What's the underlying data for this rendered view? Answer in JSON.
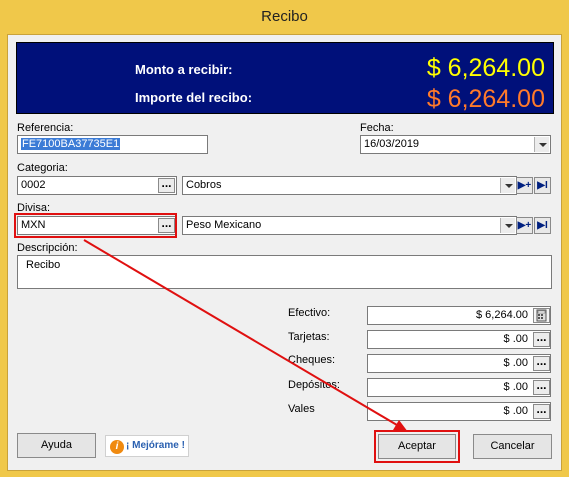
{
  "window": {
    "title": "Recibo"
  },
  "banner": {
    "monto_label": "Monto a recibir:",
    "monto_value": "$ 6,264.00",
    "importe_label": "Importe del recibo:",
    "importe_value": "$ 6,264.00"
  },
  "referencia": {
    "label": "Referencia:",
    "value": "FE7100BA37735E1"
  },
  "fecha": {
    "label": "Fecha:",
    "value": "16/03/2019"
  },
  "categoria": {
    "label": "Categoria:",
    "code": "0002",
    "name": "Cobros"
  },
  "divisa": {
    "label": "Divisa:",
    "code": "MXN",
    "name": "Peso Mexicano"
  },
  "descripcion": {
    "label": "Descripción:",
    "value": "Recibo"
  },
  "payments": [
    {
      "label": "Efectivo:",
      "value": "$ 6,264.00"
    },
    {
      "label": "Tarjetas:",
      "value": "$ .00"
    },
    {
      "label": "Cheques:",
      "value": "$ .00"
    },
    {
      "label": "Depósitos:",
      "value": "$ .00"
    },
    {
      "label": "Vales",
      "value": "$ .00"
    }
  ],
  "buttons": {
    "ayuda": "Ayuda",
    "mejorame": "¡ Mejórame !",
    "aceptar": "Aceptar",
    "cancelar": "Cancelar",
    "dots": "...",
    "add_icon": "▶+",
    "jump_icon": "▶I"
  },
  "colors": {
    "banner_bg": "#00107a",
    "monto_color": "#ffff00",
    "importe_color": "#ff7a2a",
    "annotation_red": "#e01010"
  }
}
